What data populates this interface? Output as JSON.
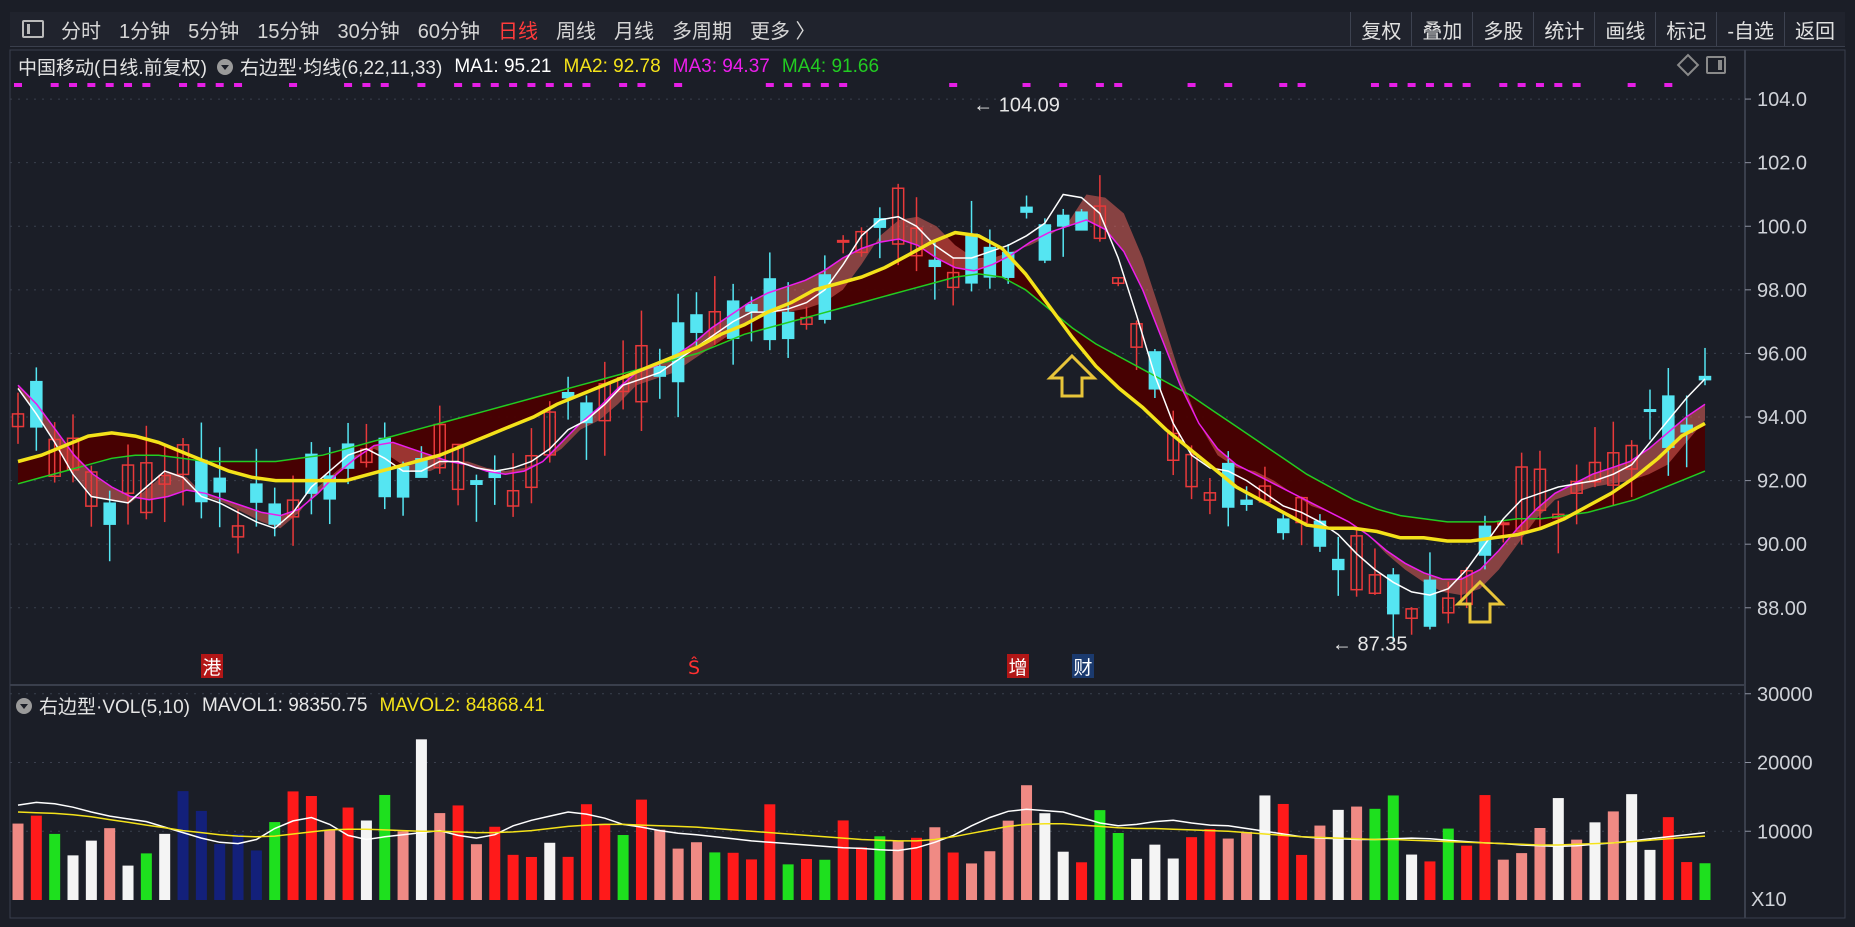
{
  "toolbar": {
    "periods": [
      "分时",
      "1分钟",
      "5分钟",
      "15分钟",
      "30分钟",
      "60分钟",
      "日线",
      "周线",
      "月线",
      "多周期",
      "更多 〉"
    ],
    "active_period": "日线",
    "right_buttons": [
      "复权",
      "叠加",
      "多股",
      "统计",
      "画线",
      "标记",
      "-自选",
      "返回"
    ]
  },
  "kline_header": {
    "title": "中国移动(日线.前复权)",
    "indicator": "右边型·均线(6,22,11,33)",
    "ma1": "MA1: 95.21",
    "ma2": "MA2: 92.78",
    "ma3": "MA3: 94.37",
    "ma4": "MA4: 91.66"
  },
  "vol_header": {
    "indicator": "右边型·VOL(5,10)",
    "mavol1": "MAVOL1: 98350.75",
    "mavol2": "MAVOL2: 84868.41"
  },
  "colors": {
    "up": "#e8393a",
    "down": "#55e5f2",
    "ma1": "#ffffff",
    "ma2": "#f4e21a",
    "ma3": "#ec1eec",
    "ma4": "#22cc22",
    "band_red": "#e0605a",
    "band_darkred": "#4a0000",
    "band_green": "#077a07",
    "band_olive": "#6d7f56",
    "vol_red": "#ff1a1a",
    "vol_pink": "#f08a84",
    "vol_green": "#1ee01e",
    "vol_white": "#f4f4f4",
    "vol_navy": "#13207a",
    "arrow": "#e8c53a"
  },
  "chart_data": [
    {
      "type": "candlestick",
      "title": "中国移动(日线.前复权)",
      "yticks": [
        "104.0",
        "102.0",
        "100.0",
        "98.00",
        "96.00",
        "94.00",
        "92.00",
        "90.00",
        "88.00"
      ],
      "ylim": [
        86.2,
        104.6
      ],
      "high_label": "104.09",
      "low_label": "87.35",
      "event_markers": [
        {
          "text": "港",
          "kind": "red"
        },
        {
          "text": "Ŝ",
          "kind": "red-text"
        },
        {
          "text": "增",
          "kind": "red"
        },
        {
          "text": "财",
          "kind": "blue"
        }
      ],
      "series": [
        {
          "name": "MA1",
          "values": [
            94.9,
            94.1,
            93.2,
            92.2,
            91.5,
            91.4,
            91.3,
            91.8,
            92.3,
            92.1,
            91.5,
            91.3,
            91.0,
            90.7,
            90.5,
            91.0,
            91.8,
            92.3,
            92.8,
            93.0,
            92.7,
            92.3,
            92.3,
            92.6,
            92.6,
            92.4,
            92.3,
            92.4,
            92.6,
            93.0,
            93.6,
            93.9,
            94.4,
            95.0,
            95.2,
            95.4,
            95.8,
            96.2,
            96.6,
            97.0,
            97.3,
            97.3,
            97.4,
            97.6,
            98.0,
            98.8,
            99.7,
            100.2,
            100.3,
            100.0,
            99.4,
            99.0,
            99.0,
            99.2,
            99.4,
            99.7,
            100.1,
            101.0,
            100.9,
            100.4,
            99.0,
            97.2,
            95.3,
            93.8,
            92.8,
            92.4,
            92.3,
            92.0,
            91.6,
            91.2,
            91.0,
            90.7,
            90.3,
            89.7,
            89.2,
            88.8,
            88.5,
            88.4,
            88.6,
            89.2,
            90.0,
            90.8,
            91.4,
            91.6,
            91.8,
            91.9,
            92.0,
            92.2,
            92.5,
            93.2,
            93.9,
            94.6,
            95.2
          ]
        },
        {
          "name": "MA2",
          "values": [
            92.6,
            92.8,
            93.1,
            93.4,
            93.5,
            93.4,
            93.2,
            92.9,
            92.6,
            92.3,
            92.1,
            92.0,
            92.0,
            92.0,
            92.0,
            92.2,
            92.4,
            92.6,
            92.8,
            93.1,
            93.4,
            93.7,
            94.0,
            94.4,
            94.7,
            95.0,
            95.3,
            95.6,
            95.9,
            96.2,
            96.6,
            96.9,
            97.3,
            97.6,
            98.0,
            98.2,
            98.4,
            98.7,
            99.1,
            99.5,
            99.8,
            99.7,
            99.3,
            98.5,
            97.5,
            96.5,
            95.6,
            94.9,
            94.3,
            93.6,
            93.0,
            92.4,
            91.8,
            91.4,
            91.0,
            90.6,
            90.5,
            90.5,
            90.4,
            90.2,
            90.2,
            90.1,
            90.1,
            90.2,
            90.3,
            90.5,
            90.8,
            91.2,
            91.6,
            92.1,
            92.7,
            93.4,
            93.8
          ]
        },
        {
          "name": "MA3",
          "values": [
            95.0,
            94.4,
            93.6,
            92.8,
            92.2,
            91.8,
            91.5,
            91.4,
            91.5,
            91.7,
            91.6,
            91.4,
            91.2,
            91.0,
            90.9,
            91.1,
            91.6,
            92.2,
            92.7,
            93.1,
            93.2,
            93.0,
            92.8,
            92.6,
            92.5,
            92.3,
            92.2,
            92.3,
            92.6,
            93.2,
            93.8,
            94.3,
            94.9,
            95.4,
            95.6,
            95.9,
            96.3,
            96.8,
            97.2,
            97.6,
            97.9,
            98.1,
            98.3,
            98.6,
            99.0,
            99.3,
            99.5,
            99.6,
            99.4,
            99.0,
            98.7,
            98.6,
            98.8,
            99.1,
            99.5,
            99.8,
            100.0,
            100.2,
            99.9,
            99.2,
            98.0,
            96.5,
            95.0,
            93.8,
            93.0,
            92.5,
            92.2,
            91.9,
            91.6,
            91.3,
            91.0,
            90.7,
            90.3,
            89.8,
            89.4,
            89.1,
            88.9,
            88.9,
            89.2,
            89.8,
            90.5,
            91.1,
            91.6,
            91.9,
            92.2,
            92.4,
            92.6,
            93.0,
            93.5,
            94.0,
            94.4
          ]
        },
        {
          "name": "MA4",
          "values": [
            91.9,
            92.1,
            92.3,
            92.5,
            92.7,
            92.8,
            92.8,
            92.7,
            92.6,
            92.6,
            92.6,
            92.6,
            92.7,
            92.8,
            93.0,
            93.2,
            93.4,
            93.6,
            93.8,
            94.0,
            94.2,
            94.4,
            94.6,
            94.8,
            95.0,
            95.2,
            95.4,
            95.6,
            95.8,
            96.0,
            96.3,
            96.6,
            96.8,
            97.0,
            97.2,
            97.4,
            97.6,
            97.8,
            98.0,
            98.2,
            98.4,
            98.5,
            98.4,
            98.0,
            97.4,
            96.8,
            96.3,
            95.9,
            95.5,
            95.1,
            94.7,
            94.2,
            93.7,
            93.2,
            92.7,
            92.2,
            91.8,
            91.4,
            91.1,
            90.9,
            90.8,
            90.7,
            90.7,
            90.7,
            90.8,
            90.8,
            90.9,
            91.0,
            91.2,
            91.4,
            91.7,
            92.0,
            92.3
          ]
        }
      ]
    },
    {
      "type": "bar",
      "title": "右边型·VOL(5,10)",
      "yticks": [
        "30000",
        "20000",
        "10000"
      ],
      "ylim": [
        0,
        32000
      ],
      "scale_label": "X10",
      "series": [
        {
          "name": "MAVOL1",
          "values": [
            13800,
            14200,
            14000,
            13500,
            12800,
            12200,
            11800,
            11400,
            10600,
            9800,
            9000,
            8400,
            8200,
            8800,
            10400,
            11500,
            12000,
            11000,
            9400,
            8800,
            9200,
            9500,
            9800,
            10100,
            9400,
            9000,
            9500,
            10800,
            11600,
            12200,
            12800,
            12500,
            11900,
            11000,
            10600,
            10100,
            9700,
            9500,
            9200,
            8900,
            8600,
            8400,
            8200,
            8000,
            7800,
            7600,
            7500,
            7300,
            7200,
            7600,
            8400,
            9400,
            10800,
            12000,
            12900,
            13200,
            13000,
            12800,
            12000,
            11200,
            10800,
            11000,
            11400,
            11600,
            11200,
            10900,
            10800,
            10400,
            10000,
            9600,
            9200,
            9000,
            8900,
            8800,
            8800,
            8900,
            9000,
            8900,
            8700,
            8500,
            8300,
            8200,
            8000,
            7900,
            7800,
            7900,
            8100,
            8300,
            8600,
            8900,
            9200,
            9500,
            9800
          ]
        },
        {
          "name": "MAVOL2",
          "values": [
            12800,
            12700,
            12600,
            12400,
            12100,
            11700,
            11300,
            10900,
            10500,
            10100,
            9800,
            9500,
            9300,
            9200,
            9300,
            9600,
            9900,
            10200,
            10300,
            10300,
            10200,
            10100,
            10000,
            10000,
            9900,
            9800,
            9800,
            9900,
            10100,
            10400,
            10700,
            10900,
            11000,
            11000,
            10900,
            10800,
            10700,
            10600,
            10400,
            10200,
            10000,
            9800,
            9600,
            9400,
            9200,
            9000,
            8800,
            8700,
            8600,
            8600,
            8800,
            9200,
            9700,
            10200,
            10700,
            11000,
            11100,
            11100,
            10900,
            10700,
            10500,
            10400,
            10400,
            10300,
            10200,
            10100,
            10000,
            9800,
            9600,
            9400,
            9200,
            9100,
            9000,
            8900,
            8800,
            8800,
            8700,
            8600,
            8500,
            8400,
            8300,
            8200,
            8100,
            8000,
            8000,
            8100,
            8200,
            8300,
            8500,
            8700,
            8900,
            9100,
            9300
          ]
        }
      ]
    }
  ]
}
